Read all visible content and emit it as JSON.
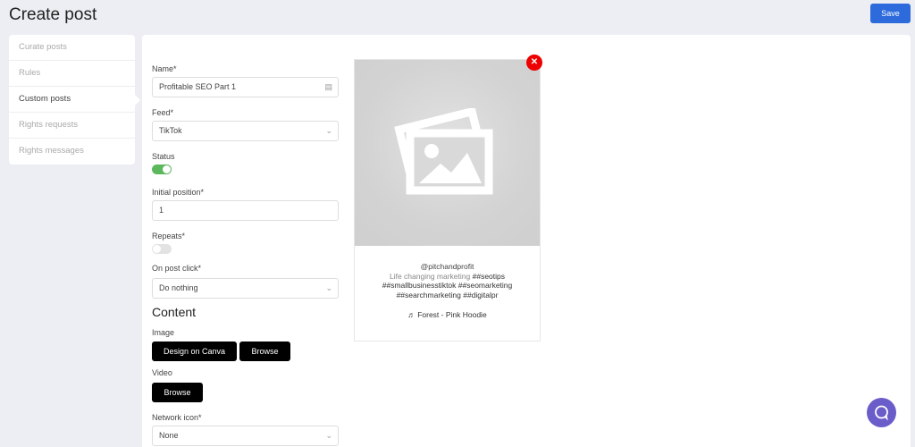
{
  "header": {
    "title": "Create post",
    "save_label": "Save"
  },
  "sidebar": {
    "items": [
      {
        "label": "Curate posts"
      },
      {
        "label": "Rules"
      },
      {
        "label": "Custom posts"
      },
      {
        "label": "Rights requests"
      },
      {
        "label": "Rights messages"
      }
    ],
    "active_index": 2
  },
  "form": {
    "name_label": "Name*",
    "name_value": "Profitable SEO Part 1",
    "feed_label": "Feed*",
    "feed_value": "TikTok",
    "status_label": "Status",
    "status_on": true,
    "initial_position_label": "Initial position*",
    "initial_position_value": "1",
    "repeats_label": "Repeats*",
    "repeats_on": false,
    "on_post_click_label": "On post click*",
    "on_post_click_value": "Do nothing",
    "content_title": "Content",
    "image_label": "Image",
    "design_canva_label": "Design on Canva",
    "image_browse_label": "Browse",
    "video_label": "Video",
    "video_browse_label": "Browse",
    "network_icon_label": "Network icon*",
    "network_icon_value": "None"
  },
  "preview": {
    "handle": "@pitchandprofit",
    "caption_muted": "Life changing marketing",
    "caption_tags_1": "##seotips",
    "caption_line_2": "##smallbusinesstiktok ##seomarketing",
    "caption_line_3": "##searchmarketing ##digitalpr",
    "music": "♬ Forest - Pink Hoodie"
  },
  "colors": {
    "accent": "#2d6bdc",
    "toggle_on": "#5cb85c",
    "close": "#ee0000",
    "help": "#6a5cc9"
  }
}
